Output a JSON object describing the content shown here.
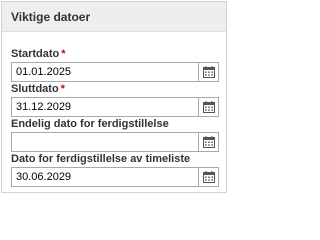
{
  "panel": {
    "title": "Viktige datoer"
  },
  "fields": [
    {
      "label": "Startdato",
      "required": "*",
      "value": "01.01.2025",
      "icon": "calendar-icon"
    },
    {
      "label": "Sluttdato",
      "required": "*",
      "value": "31.12.2029",
      "icon": "calendar-icon"
    },
    {
      "label": "Endelig dato for ferdigstillelse",
      "required": "",
      "value": "",
      "icon": "calendar-icon"
    },
    {
      "label": "Dato for ferdigstillelse av timeliste",
      "required": "",
      "value": "30.06.2029",
      "icon": "calendar-icon"
    }
  ],
  "colors": {
    "required": "#cc0000",
    "header_bg": "#eeeeee",
    "border": "#a9a9a9"
  }
}
